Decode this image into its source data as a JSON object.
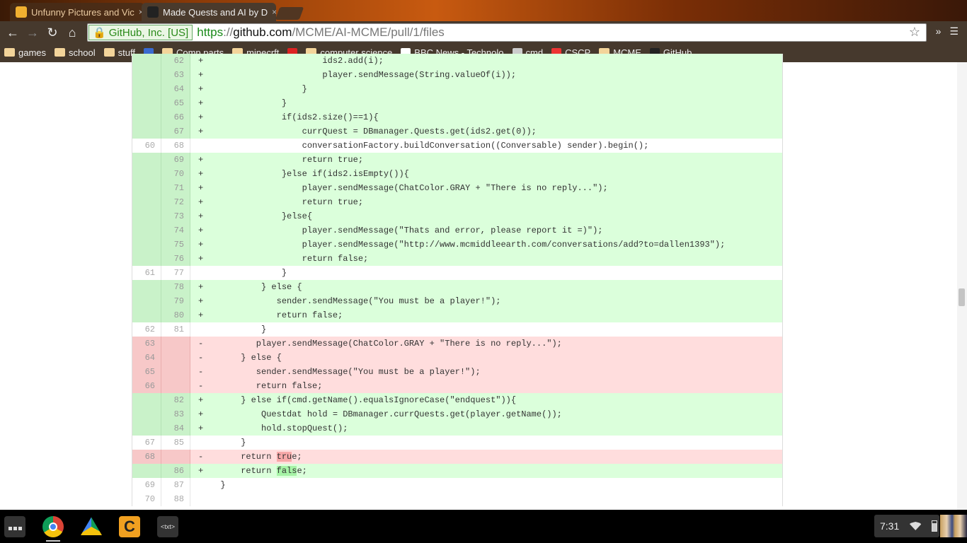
{
  "browser": {
    "tabs": [
      {
        "title": "Unfunny Pictures and Vic",
        "active": false,
        "icon": "minecraft-favicon"
      },
      {
        "title": "Made Quests and AI by D",
        "active": true,
        "icon": "github-favicon"
      }
    ],
    "ev_label": "GitHub, Inc. [US]",
    "url": {
      "scheme": "https",
      "sep": "://",
      "domain": "github.com",
      "path": "/MCME/AI-MCME/pull/1/files"
    },
    "bookmarks": [
      {
        "label": "games",
        "icon": "folder-icon"
      },
      {
        "label": "school",
        "icon": "folder-icon"
      },
      {
        "label": "stuff",
        "icon": "folder-icon"
      },
      {
        "label": "",
        "icon": "blue-logo-icon"
      },
      {
        "label": "Comp parts",
        "icon": "folder-icon"
      },
      {
        "label": "minecrft",
        "icon": "folder-icon"
      },
      {
        "label": "",
        "icon": "youtube-icon"
      },
      {
        "label": "computer science",
        "icon": "folder-icon"
      },
      {
        "label": "BBC News - Technolo",
        "icon": "bbc-icon"
      },
      {
        "label": "cmd",
        "icon": "page-icon"
      },
      {
        "label": "CSCP",
        "icon": "cscp-icon"
      },
      {
        "label": "MCME",
        "icon": "folder-icon"
      },
      {
        "label": "GitHub",
        "icon": "github-icon"
      }
    ]
  },
  "diff": {
    "rows": [
      {
        "old": "",
        "new": "62",
        "type": "add",
        "code": "                      ids2.add(i);"
      },
      {
        "old": "",
        "new": "63",
        "type": "add",
        "code": "                      player.sendMessage(String.valueOf(i));"
      },
      {
        "old": "",
        "new": "64",
        "type": "add",
        "code": "                  }"
      },
      {
        "old": "",
        "new": "65",
        "type": "add",
        "code": "              }"
      },
      {
        "old": "",
        "new": "66",
        "type": "add",
        "code": "              if(ids2.size()==1){"
      },
      {
        "old": "",
        "new": "67",
        "type": "add",
        "code": "                  currQuest = DBmanager.Quests.get(ids2.get(0));"
      },
      {
        "old": "60",
        "new": "68",
        "type": "ctx",
        "code": "                  conversationFactory.buildConversation((Conversable) sender).begin();"
      },
      {
        "old": "",
        "new": "69",
        "type": "add",
        "code": "                  return true;"
      },
      {
        "old": "",
        "new": "70",
        "type": "add",
        "code": "              }else if(ids2.isEmpty()){"
      },
      {
        "old": "",
        "new": "71",
        "type": "add",
        "code": "                  player.sendMessage(ChatColor.GRAY + \"There is no reply...\");"
      },
      {
        "old": "",
        "new": "72",
        "type": "add",
        "code": "                  return true;"
      },
      {
        "old": "",
        "new": "73",
        "type": "add",
        "code": "              }else{"
      },
      {
        "old": "",
        "new": "74",
        "type": "add",
        "code": "                  player.sendMessage(\"Thats and error, please report it =)\");"
      },
      {
        "old": "",
        "new": "75",
        "type": "add",
        "code": "                  player.sendMessage(\"http://www.mcmiddleearth.com/conversations/add?to=dallen1393\");"
      },
      {
        "old": "",
        "new": "76",
        "type": "add",
        "code": "                  return false;"
      },
      {
        "old": "61",
        "new": "77",
        "type": "ctx",
        "code": "              }"
      },
      {
        "old": "",
        "new": "78",
        "type": "add",
        "code": "          } else {"
      },
      {
        "old": "",
        "new": "79",
        "type": "add",
        "code": "             sender.sendMessage(\"You must be a player!\");"
      },
      {
        "old": "",
        "new": "80",
        "type": "add",
        "code": "             return false;"
      },
      {
        "old": "62",
        "new": "81",
        "type": "ctx",
        "code": "          }"
      },
      {
        "old": "63",
        "new": "",
        "type": "del",
        "code": "         player.sendMessage(ChatColor.GRAY + \"There is no reply...\");"
      },
      {
        "old": "64",
        "new": "",
        "type": "del",
        "code": "      } else {"
      },
      {
        "old": "65",
        "new": "",
        "type": "del",
        "code": "         sender.sendMessage(\"You must be a player!\");"
      },
      {
        "old": "66",
        "new": "",
        "type": "del",
        "code": "         return false;"
      },
      {
        "old": "",
        "new": "82",
        "type": "add",
        "code": "      } else if(cmd.getName().equalsIgnoreCase(\"endquest\")){"
      },
      {
        "old": "",
        "new": "83",
        "type": "add",
        "code": "          Questdat hold = DBmanager.currQuests.get(player.getName());"
      },
      {
        "old": "",
        "new": "84",
        "type": "add",
        "code": "          hold.stopQuest();"
      },
      {
        "old": "67",
        "new": "85",
        "type": "ctx",
        "code": "      }"
      },
      {
        "old": "68",
        "new": "",
        "type": "del",
        "code": "      return ",
        "hl": "tru",
        "post": "e;"
      },
      {
        "old": "",
        "new": "86",
        "type": "add",
        "code": "      return ",
        "hl": "fals",
        "post": "e;"
      },
      {
        "old": "69",
        "new": "87",
        "type": "ctx",
        "code": "  }"
      },
      {
        "old": "70",
        "new": "88",
        "type": "ctx",
        "code": ""
      }
    ]
  },
  "shelf": {
    "apps": [
      "app-launcher-icon",
      "chrome-icon",
      "drive-icon",
      "codecademy-icon",
      "text-editor-icon"
    ],
    "text_app_label": "<txt>",
    "clock": "7:31"
  }
}
